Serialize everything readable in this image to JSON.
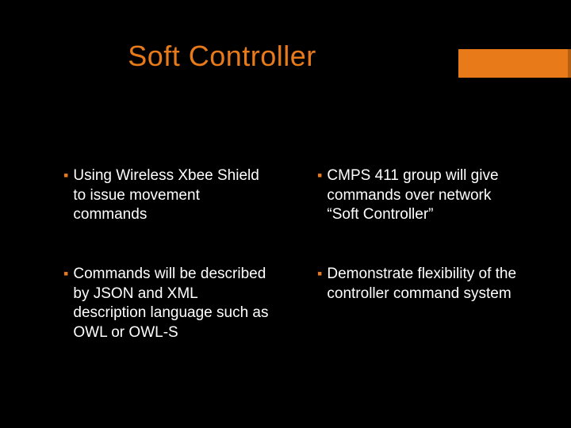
{
  "title": "Soft Controller",
  "accent_color": "#e87a1a",
  "bullets": {
    "top_left": "Using Wireless Xbee Shield to issue movement commands",
    "top_right": "CMPS 411 group will give commands over network “Soft Controller”",
    "bottom_left": "Commands will be described by JSON and XML description language such as OWL or OWL-S",
    "bottom_right": "Demonstrate flexibility of the controller command system"
  }
}
